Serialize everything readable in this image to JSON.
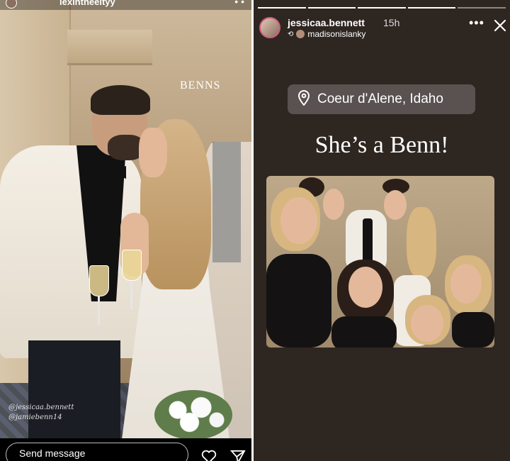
{
  "left_story": {
    "username": "lexintheeityy",
    "sign_text": "BENNS",
    "mentions": [
      "@jessicaa.bennett",
      "@jamiebenn14"
    ],
    "message_placeholder": "Send message",
    "icons": {
      "like": "heart-icon",
      "share": "paper-plane-icon"
    }
  },
  "right_story": {
    "progress_segments": 5,
    "progress_done": 4,
    "username": "jessicaa.bennett",
    "time": "15h",
    "repost_user": "madisonislanky",
    "location": "Coeur d'Alene, Idaho",
    "headline": "She’s a Benn!",
    "icons": {
      "more": "more-icon",
      "close": "close-icon",
      "location": "location-pin-icon",
      "repost": "repost-icon"
    }
  },
  "colors": {
    "right_background": "#2e2621",
    "pill_background": "#595250",
    "text": "#ffffff"
  }
}
